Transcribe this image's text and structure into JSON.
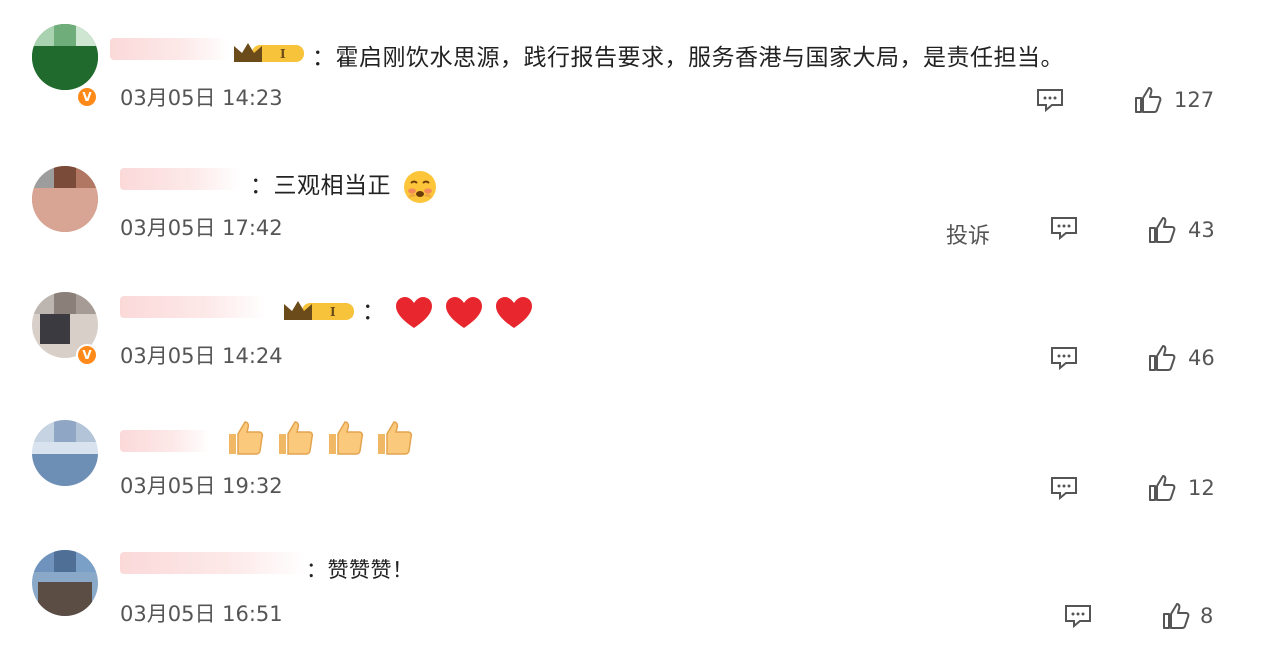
{
  "comments": [
    {
      "text": "：霍启刚饮水思源，践行报告要求，服务香港与国家大局，是责任担当。",
      "time": "03月05日 14:23",
      "likes": "127"
    },
    {
      "text": "：三观相当正",
      "time": "03月05日 17:42",
      "report": "投诉",
      "likes": "43"
    },
    {
      "text": "：",
      "time": "03月05日 14:24",
      "likes": "46"
    },
    {
      "text": "",
      "time": "03月05日 19:32",
      "likes": "12"
    },
    {
      "text": "：赞赞赞！",
      "time": "03月05日 16:51",
      "likes": "8"
    }
  ],
  "icons": {
    "reply": "comment-icon",
    "like": "thumbs-up-icon",
    "badge": "vip-crown-badge",
    "verified": "verified-v-badge",
    "emoji_heart": "heart-emoji",
    "emoji_thumb": "thumbs-up-emoji",
    "emoji_blush": "blushing-face-emoji"
  },
  "colors": {
    "verified_badge": "#ff8a1a",
    "heart": "#e8262e",
    "crown_gold": "#f7c33b"
  }
}
